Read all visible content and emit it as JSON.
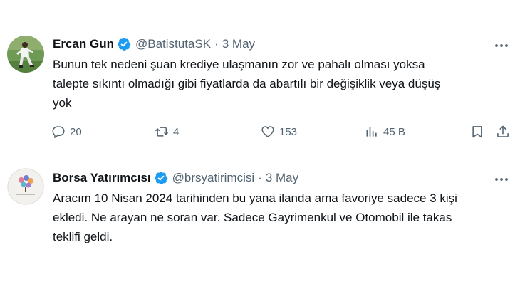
{
  "tweets": [
    {
      "author_name": "Ercan Gun",
      "handle": "@BatistutaSK",
      "separator": "·",
      "date": "3 May",
      "text": "Bunun tek nedeni şuan krediye ulaşmanın zor ve pahalı olması yoksa\ntalepte sıkıntı olmadığı gibi fiyatlarda da abartılı bir değişiklik veya düşüş\nyok",
      "replies": "20",
      "reposts": "4",
      "likes": "153",
      "views": "45 B"
    },
    {
      "author_name": "Borsa Yatırımcısı",
      "handle": "@brsyatirimcisi",
      "separator": "·",
      "date": "3 May",
      "text": "Aracım 10 Nisan 2024 tarihinden bu yana ilanda ama favoriye sadece 3 kişi\nekledi. Ne arayan ne soran var. Sadece Gayrimenkul ve Otomobil ile takas\nteklifi geldi."
    }
  ],
  "colors": {
    "verified": "#1d9bf0",
    "secondary_text": "#536471",
    "primary_text": "#0f1419",
    "divider": "#eff3f4"
  },
  "icons": [
    "verified-badge-icon",
    "more-icon",
    "reply-icon",
    "repost-icon",
    "like-icon",
    "views-icon",
    "bookmark-icon",
    "share-icon"
  ]
}
